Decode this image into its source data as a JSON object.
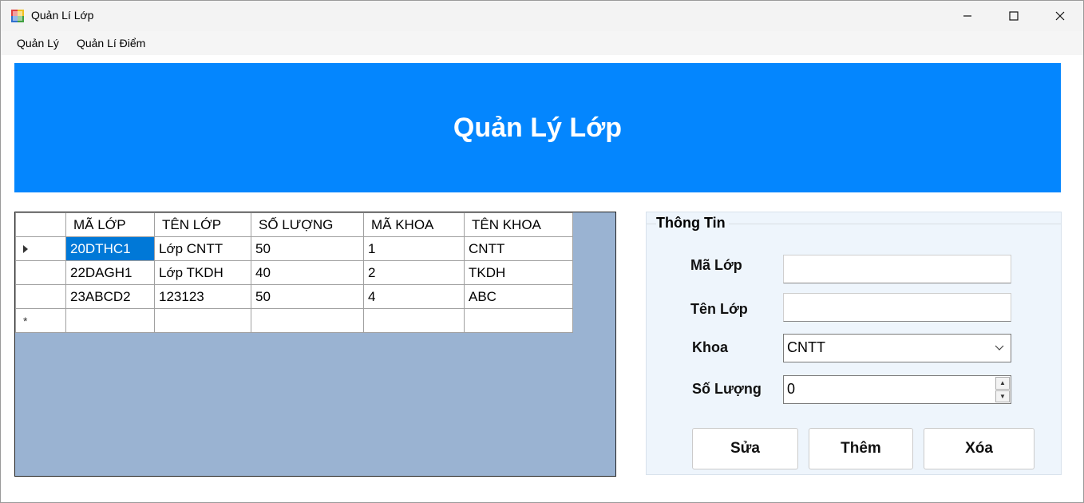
{
  "window": {
    "title": "Quản Lí Lớp"
  },
  "menu": {
    "items": [
      "Quản Lý",
      "Quản Lí Điểm"
    ]
  },
  "banner": {
    "title": "Quản Lý Lớp",
    "color": "#0486fe"
  },
  "grid": {
    "columns": [
      "MÃ LỚP",
      "TÊN LỚP",
      "SỐ LƯỢNG",
      "MÃ KHOA",
      "TÊN KHOA"
    ],
    "rows": [
      [
        "20DTHC1",
        "Lớp CNTT",
        "50",
        "1",
        "CNTT"
      ],
      [
        "22DAGH1",
        "Lớp TKDH",
        "40",
        "2",
        "TKDH"
      ],
      [
        "23ABCD2",
        "123123",
        "50",
        "4",
        "ABC"
      ]
    ],
    "selected_row": 0,
    "background_color": "#9ab3d2"
  },
  "info": {
    "legend": "Thông Tin",
    "ma_lop_label": "Mã Lớp",
    "ma_lop_value": "",
    "ten_lop_label": "Tên Lớp",
    "ten_lop_value": "",
    "khoa_label": "Khoa",
    "khoa_value": "CNTT",
    "so_luong_label": "Số Lượng",
    "so_luong_value": "0"
  },
  "buttons": {
    "sua": "Sửa",
    "them": "Thêm",
    "xoa": "Xóa"
  }
}
